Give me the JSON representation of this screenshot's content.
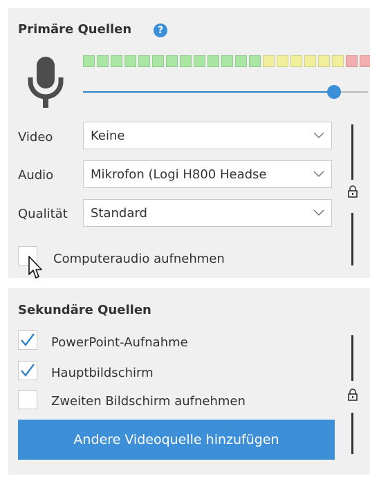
{
  "primary": {
    "title": "Primäre Quellen",
    "help_icon": "?",
    "meter": {
      "segments": [
        "g",
        "g",
        "g",
        "g",
        "g",
        "g",
        "g",
        "g",
        "g",
        "g",
        "g",
        "g",
        "g",
        "y",
        "y",
        "y",
        "y",
        "y",
        "y",
        "r",
        "r",
        "r",
        "r"
      ]
    },
    "volume_slider": {
      "value": 0.88
    },
    "fields": [
      {
        "label": "Video",
        "value": "Keine"
      },
      {
        "label": "Audio",
        "value": "Mikrofon (Logi H800 Headse"
      },
      {
        "label": "Qualität",
        "value": "Standard"
      }
    ],
    "computer_audio": {
      "label": "Computeraudio aufnehmen",
      "checked": false
    }
  },
  "secondary": {
    "title": "Sekundäre Quellen",
    "items": [
      {
        "label": "PowerPoint-Aufnahme",
        "checked": true
      },
      {
        "label": "Hauptbildschirm",
        "checked": true
      },
      {
        "label": "Zweiten Bildschirm aufnehmen",
        "checked": false
      }
    ],
    "add_button": "Andere Videoquelle hinzufügen"
  },
  "colors": {
    "accent": "#3b8ed8",
    "panel_bg": "#f0f0f0",
    "meter_green": "#a9e6a3",
    "meter_yellow": "#f1ee9c",
    "meter_red": "#f2aeae"
  },
  "icons": [
    "microphone-icon",
    "help-icon",
    "chevron-down-icon",
    "lock-icon",
    "checkmark-icon",
    "mouse-cursor-icon"
  ]
}
